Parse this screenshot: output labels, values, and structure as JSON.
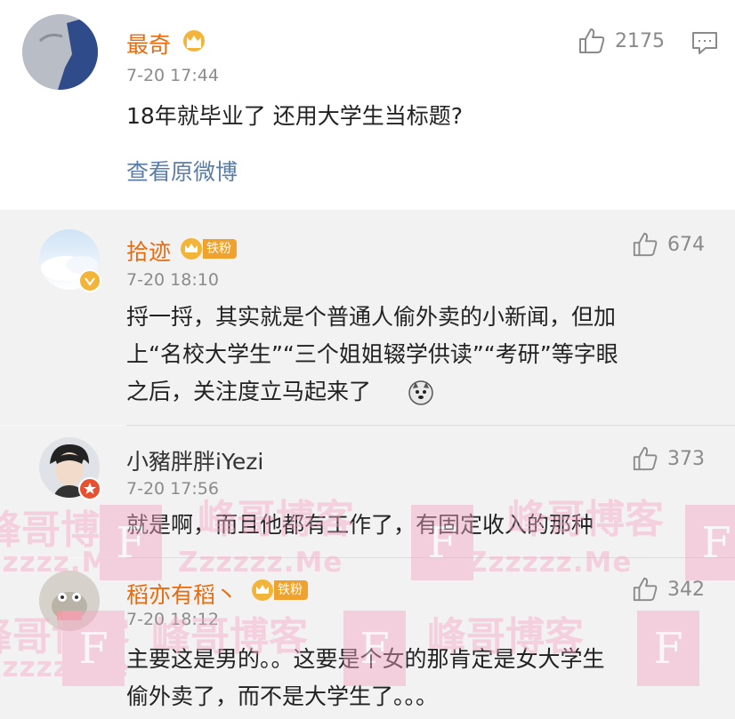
{
  "main_comment": {
    "username": "最奇",
    "time": "7-20 17:44",
    "likes": "2175",
    "text": "18年就毕业了 还用大学生当标题?",
    "view_original": "查看原微博"
  },
  "replies": [
    {
      "username": "拾迹",
      "badge": "铁粉",
      "time": "7-20 18:10",
      "likes": "674",
      "lines": [
        "捋一捋，其实就是个普通人偷外卖的小新闻，但加",
        "上“名校大学生”“三个姐姐辍学供读”“考研”等字眼",
        "之后，关注度立马起来了"
      ]
    },
    {
      "username": "小豬胖胖iYezi",
      "time": "7-20 17:56",
      "likes": "373",
      "lines": [
        "就是啊，而且他都有工作了，有固定收入的那种"
      ]
    },
    {
      "username": "稻亦有稻丶",
      "badge": "铁粉",
      "time": "7-20 18:12",
      "likes": "342",
      "lines": [
        "主要这是男的。。这要是个女的那肯定是女大学生",
        "偷外卖了，而不是大学生了。。。"
      ]
    }
  ],
  "watermark": {
    "cn": "峰哥博客",
    "en": "Zzzzzz.Me",
    "letter": "F"
  },
  "icons": {
    "like": "thumbs-up-icon",
    "comment": "comment-icon",
    "crown": "vip-crown-icon",
    "verified": "verified-badge-icon",
    "emoji": "husky-emoji-icon"
  },
  "colors": {
    "username": "#e86b0f",
    "link": "#5b7da8",
    "badge": "#f0a22e"
  }
}
